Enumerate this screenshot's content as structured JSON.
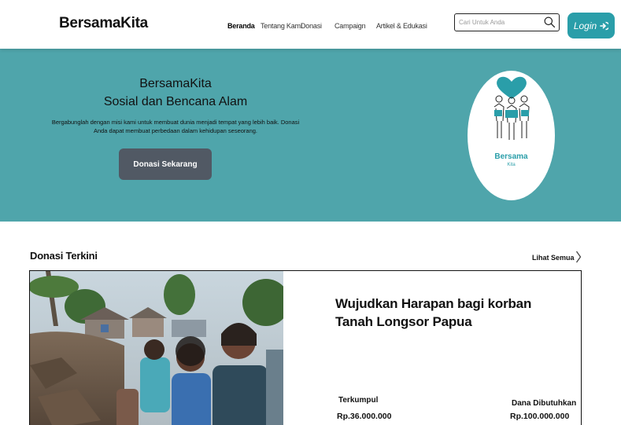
{
  "header": {
    "brand": "BersamaKita",
    "nav": [
      {
        "label": "Beranda",
        "active": true
      },
      {
        "label": "Tentang Kami",
        "active": false
      },
      {
        "label": "Donasi",
        "active": false
      },
      {
        "label": "Campaign",
        "active": false
      },
      {
        "label": "Artikel & Edukasi",
        "active": false
      }
    ],
    "search_placeholder": "Cari Untuk Anda",
    "search_icon": "search-icon",
    "login_label": "Login",
    "login_icon": "login-arrow-icon"
  },
  "hero": {
    "title_line1": "BersamaKita",
    "title_line2": "Sosial dan Bencana Alam",
    "description": "Bergabunglah dengan misi kami untuk membuat dunia menjadi tempat yang lebih baik. Donasi Anda dapat membuat perbedaan dalam kehidupan seseorang.",
    "cta_label": "Donasi Sekarang",
    "logo_word": "Bersama",
    "logo_sub": "Kita",
    "background_color": "#4fa5ab"
  },
  "recent": {
    "title": "Donasi Terkini",
    "see_all_label": "Lihat Semua",
    "card": {
      "title": "Wujudkan Harapan bagi korban Tanah Longsor Papua",
      "collected_label": "Terkumpul",
      "collected_value": "Rp.36.000.000",
      "needed_label": "Dana Dibutuhkan",
      "needed_value": "Rp.100.000.000"
    }
  },
  "colors": {
    "accent": "#2a9ea9",
    "button_dark": "#515964"
  }
}
